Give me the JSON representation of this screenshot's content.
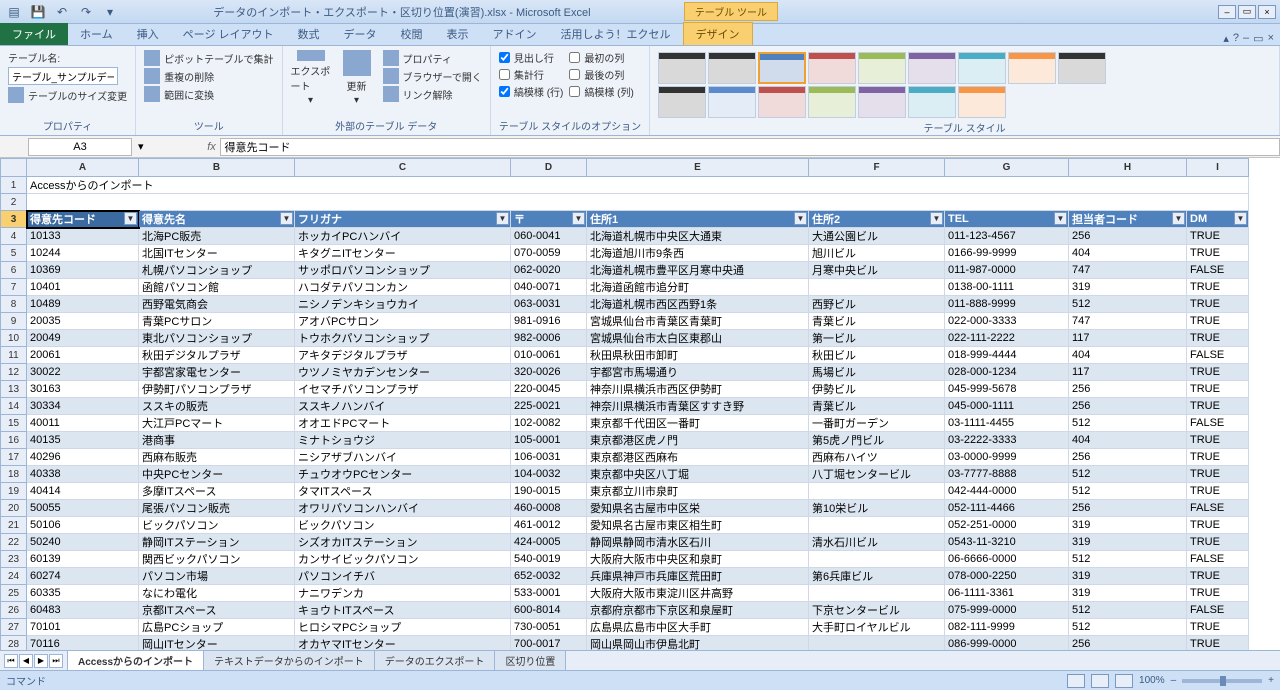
{
  "title": "データのインポート・エクスポート・区切り位置(演習).xlsx - Microsoft Excel",
  "table_tools_label": "テーブル ツール",
  "qat": {
    "save": "💾",
    "undo": "↶",
    "redo": "↷",
    "dd": "▾"
  },
  "winctrl": {
    "min": "–",
    "max": "▭",
    "close": "×"
  },
  "tabs": {
    "file": "ファイル",
    "items": [
      "ホーム",
      "挿入",
      "ページ レイアウト",
      "数式",
      "データ",
      "校閲",
      "表示",
      "アドイン",
      "活用しよう！エクセル"
    ],
    "design": "デザイン"
  },
  "help": {
    "up": "▴",
    "q": "?",
    "min2": "–",
    "max2": "▭",
    "close2": "×"
  },
  "ribbon": {
    "g1": {
      "name_lbl": "テーブル名:",
      "name_val": "テーブル_サンプルデータベ",
      "resize": "テーブルのサイズ変更",
      "label": "プロパティ"
    },
    "g2": {
      "pivot": "ピボットテーブルで集計",
      "dedup": "重複の削除",
      "range": "範囲に変換",
      "label": "ツール"
    },
    "g3": {
      "export": "エクスポート",
      "refresh": "更新",
      "dd": "▾",
      "prop": "プロパティ",
      "browser": "ブラウザーで開く",
      "unlink": "リンク解除",
      "label": "外部のテーブル データ"
    },
    "g4": {
      "header": "見出し行",
      "total": "集計行",
      "band_r": "縞模様 (行)",
      "first": "最初の列",
      "last": "最後の列",
      "band_c": "縞模様 (列)",
      "label": "テーブル スタイルのオプション"
    },
    "g5": {
      "label": "テーブル スタイル"
    }
  },
  "namebox": "A3",
  "formula": "得意先コード",
  "fx": "fx",
  "dd_glyph": "▼",
  "cols_letters": [
    "A",
    "B",
    "C",
    "D",
    "E",
    "F",
    "G",
    "H",
    "I"
  ],
  "row1_cell": "Accessからのインポート",
  "headers": [
    "得意先コード",
    "得意先名",
    "フリガナ",
    "〒",
    "住所1",
    "住所2",
    "TEL",
    "担当者コード",
    "DM"
  ],
  "rows": [
    {
      "n": 4,
      "d": [
        "10133",
        "北海PC販売",
        "ホッカイPCハンバイ",
        "060-0041",
        "北海道札幌市中央区大通東",
        "大通公園ビル",
        "011-123-4567",
        "256",
        "TRUE"
      ]
    },
    {
      "n": 5,
      "d": [
        "10244",
        "北国ITセンター",
        "キタグニITセンター",
        "070-0059",
        "北海道旭川市9条西",
        "旭川ビル",
        "0166-99-9999",
        "404",
        "TRUE"
      ]
    },
    {
      "n": 6,
      "d": [
        "10369",
        "札幌パソコンショップ",
        "サッポロパソコンショップ",
        "062-0020",
        "北海道札幌市豊平区月寒中央通",
        "月寒中央ビル",
        "011-987-0000",
        "747",
        "FALSE"
      ]
    },
    {
      "n": 7,
      "d": [
        "10401",
        "函館パソコン館",
        "ハコダテパソコンカン",
        "040-0071",
        "北海道函館市追分町",
        "",
        "0138-00-1111",
        "319",
        "TRUE"
      ]
    },
    {
      "n": 8,
      "d": [
        "10489",
        "西野電気商会",
        "ニシノデンキショウカイ",
        "063-0031",
        "北海道札幌市西区西野1条",
        "西野ビル",
        "011-888-9999",
        "512",
        "TRUE"
      ]
    },
    {
      "n": 9,
      "d": [
        "20035",
        "青葉PCサロン",
        "アオバPCサロン",
        "981-0916",
        "宮城県仙台市青葉区青葉町",
        "青葉ビル",
        "022-000-3333",
        "747",
        "TRUE"
      ]
    },
    {
      "n": 10,
      "d": [
        "20049",
        "東北パソコンショップ",
        "トウホクパソコンショップ",
        "982-0006",
        "宮城県仙台市太白区東郡山",
        "第一ビル",
        "022-111-2222",
        "117",
        "TRUE"
      ]
    },
    {
      "n": 11,
      "d": [
        "20061",
        "秋田デジタルプラザ",
        "アキタデジタルプラザ",
        "010-0061",
        "秋田県秋田市卸町",
        "秋田ビル",
        "018-999-4444",
        "404",
        "FALSE"
      ]
    },
    {
      "n": 12,
      "d": [
        "30022",
        "宇都宮家電センター",
        "ウツノミヤカデンセンター",
        "320-0026",
        "宇都宮市馬場通り",
        "馬場ビル",
        "028-000-1234",
        "117",
        "TRUE"
      ]
    },
    {
      "n": 13,
      "d": [
        "30163",
        "伊勢町パソコンプラザ",
        "イセマチパソコンプラザ",
        "220-0045",
        "神奈川県横浜市西区伊勢町",
        "伊勢ビル",
        "045-999-5678",
        "256",
        "TRUE"
      ]
    },
    {
      "n": 14,
      "d": [
        "30334",
        "ススキの販売",
        "ススキノハンバイ",
        "225-0021",
        "神奈川県横浜市青葉区すすき野",
        "青葉ビル",
        "045-000-1111",
        "256",
        "TRUE"
      ]
    },
    {
      "n": 15,
      "d": [
        "40011",
        "大江戸PCマート",
        "オオエドPCマート",
        "102-0082",
        "東京都千代田区一番町",
        "一番町ガーデン",
        "03-1111-4455",
        "512",
        "FALSE"
      ]
    },
    {
      "n": 16,
      "d": [
        "40135",
        "港商事",
        "ミナトショウジ",
        "105-0001",
        "東京都港区虎ノ門",
        "第5虎ノ門ビル",
        "03-2222-3333",
        "404",
        "TRUE"
      ]
    },
    {
      "n": 17,
      "d": [
        "40296",
        "西麻布販売",
        "ニシアザブハンバイ",
        "106-0031",
        "東京都港区西麻布",
        "西麻布ハイツ",
        "03-0000-9999",
        "256",
        "TRUE"
      ]
    },
    {
      "n": 18,
      "d": [
        "40338",
        "中央PCセンター",
        "チュウオウPCセンター",
        "104-0032",
        "東京都中央区八丁堀",
        "八丁堀センタービル",
        "03-7777-8888",
        "512",
        "TRUE"
      ]
    },
    {
      "n": 19,
      "d": [
        "40414",
        "多摩ITスペース",
        "タマITスペース",
        "190-0015",
        "東京都立川市泉町",
        "",
        "042-444-0000",
        "512",
        "TRUE"
      ]
    },
    {
      "n": 20,
      "d": [
        "50055",
        "尾張パソコン販売",
        "オワリパソコンハンバイ",
        "460-0008",
        "愛知県名古屋市中区栄",
        "第10栄ビル",
        "052-111-4466",
        "256",
        "FALSE"
      ]
    },
    {
      "n": 21,
      "d": [
        "50106",
        "ビックパソコン",
        "ビックパソコン",
        "461-0012",
        "愛知県名古屋市東区相生町",
        "",
        "052-251-0000",
        "319",
        "TRUE"
      ]
    },
    {
      "n": 22,
      "d": [
        "50240",
        "静岡ITステーション",
        "シズオカITステーション",
        "424-0005",
        "静岡県静岡市清水区石川",
        "清水石川ビル",
        "0543-11-3210",
        "319",
        "TRUE"
      ]
    },
    {
      "n": 23,
      "d": [
        "60139",
        "関西ビックパソコン",
        "カンサイビックパソコン",
        "540-0019",
        "大阪府大阪市中央区和泉町",
        "",
        "06-6666-0000",
        "512",
        "FALSE"
      ]
    },
    {
      "n": 24,
      "d": [
        "60274",
        "パソコン市場",
        "パソコンイチバ",
        "652-0032",
        "兵庫県神戸市兵庫区荒田町",
        "第6兵庫ビル",
        "078-000-2250",
        "319",
        "TRUE"
      ]
    },
    {
      "n": 25,
      "d": [
        "60335",
        "なにわ電化",
        "ナニワデンカ",
        "533-0001",
        "大阪府大阪市東淀川区井高野",
        "",
        "06-1111-3361",
        "319",
        "TRUE"
      ]
    },
    {
      "n": 26,
      "d": [
        "60483",
        "京都ITスペース",
        "キョウトITスペース",
        "600-8014",
        "京都府京都市下京区和泉屋町",
        "下京センタービル",
        "075-999-0000",
        "512",
        "FALSE"
      ]
    },
    {
      "n": 27,
      "d": [
        "70101",
        "広島PCショップ",
        "ヒロシマPCショップ",
        "730-0051",
        "広島県広島市中区大手町",
        "大手町ロイヤルビル",
        "082-111-9999",
        "512",
        "TRUE"
      ]
    },
    {
      "n": 28,
      "d": [
        "70116",
        "岡山ITセンター",
        "オカヤマITセンター",
        "700-0017",
        "岡山県岡山市伊島北町",
        "",
        "086-999-0000",
        "256",
        "TRUE"
      ]
    }
  ],
  "sheets": {
    "active": "Accessからのインポート",
    "others": [
      "テキストデータからのインポート",
      "データのエクスポート",
      "区切り位置"
    ]
  },
  "status": {
    "left": "コマンド",
    "zoom": "100%",
    "minus": "–",
    "plus": "+"
  },
  "chart_data": {
    "type": "table",
    "title": "Accessからのインポート"
  }
}
